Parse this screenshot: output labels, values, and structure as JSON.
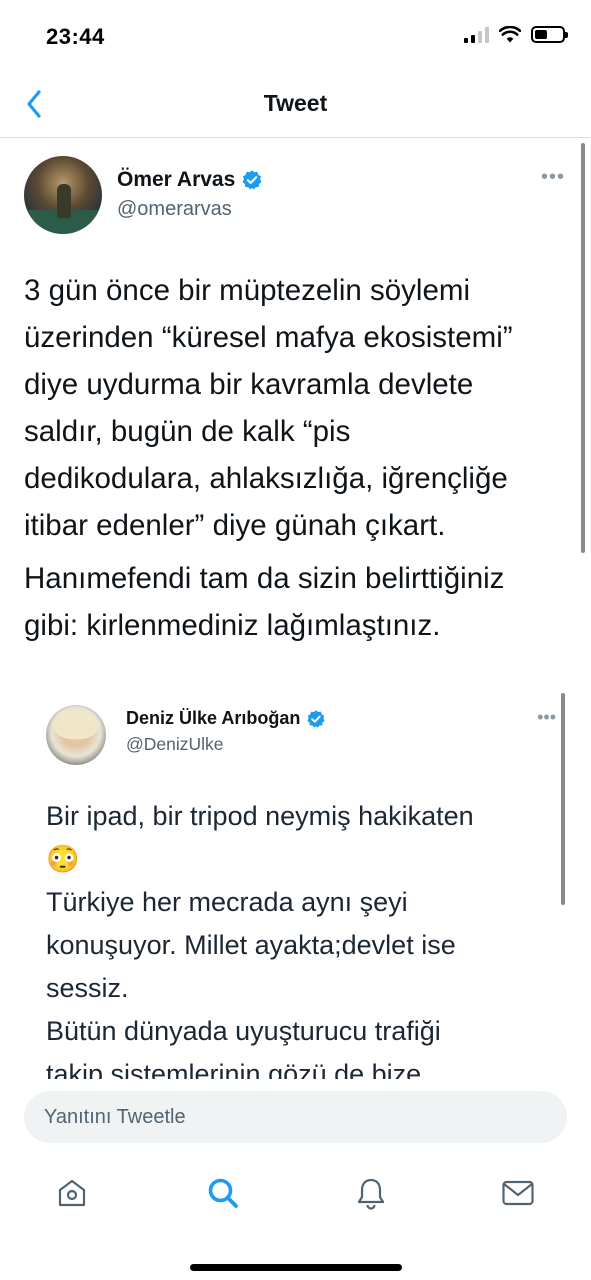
{
  "status_bar": {
    "time": "23:44"
  },
  "nav": {
    "title": "Tweet",
    "back_icon": "chevron-left-icon"
  },
  "tweet": {
    "author_name": "Ömer Arvas",
    "author_handle": "@omerarvas",
    "verified": true,
    "more_label": "•••",
    "paragraphs": [
      "3 gün önce bir müptezelin söylemi\nüzerinden “küresel mafya ekosistemi”\ndiye uydurma bir kavramla devlete\nsaldır, bugün de kalk “pis\ndedikodulara, ahlaksızlığa, iğrençliğe\nitibar edenler” diye günah çıkart.",
      "Hanımefendi tam da sizin belirttiğiniz\ngibi: kirlenmediniz lağımlaştınız."
    ]
  },
  "quoted_tweet": {
    "author_name": "Deniz Ülke Arıboğan",
    "author_handle": "@DenizUlke",
    "verified": true,
    "more_label": "•••",
    "text": "Bir ipad, bir tripod  neymiş hakikaten\n😳\nTürkiye her mecrada aynı şeyi\nkonuşuyor. Millet ayakta;devlet ise\nsessiz.\nBütün dünyada uyuşturucu trafiği\ntakip sistemlerinin gözü de bize"
  },
  "reply": {
    "placeholder": "Yanıtını Tweetle"
  },
  "tab_bar": {
    "tabs": [
      {
        "name": "home",
        "icon": "home-icon"
      },
      {
        "name": "search",
        "icon": "search-icon",
        "active": true
      },
      {
        "name": "notifications",
        "icon": "bell-icon"
      },
      {
        "name": "messages",
        "icon": "mail-icon"
      }
    ]
  },
  "colors": {
    "accent": "#1d9bf0",
    "text": "#0f1419",
    "secondary": "#536471",
    "reply_bg": "#eff3f4"
  }
}
